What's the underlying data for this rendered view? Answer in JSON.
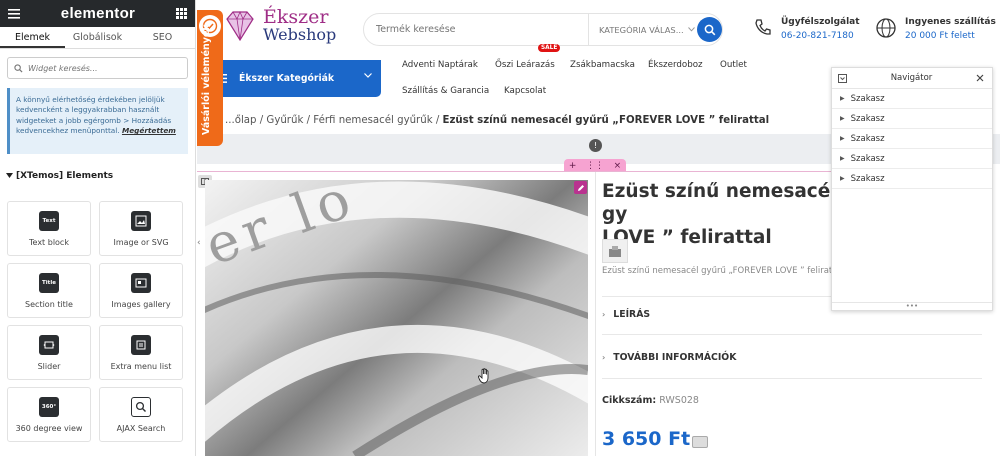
{
  "panel": {
    "logo": "elementor",
    "tabs": [
      "Elemek",
      "Globálisok",
      "SEO"
    ],
    "search_placeholder": "Widget keresés...",
    "notice_text": "A könnyű elérhetőség érdekében jelöljük kedvencként a leggyakrabban használt widgeteket a jobb egérgomb > Hozzáadás kedvencekhez menüponttal.",
    "notice_link": "Megértettem",
    "section_title": "[XTemos] Elements",
    "widgets": [
      "Text block",
      "Image or SVG",
      "Section title",
      "Images gallery",
      "Slider",
      "Extra menu list",
      "360 degree view",
      "AJAX Search"
    ],
    "widget_icon_texts": [
      "Text",
      "",
      "Title",
      "",
      "",
      "",
      "360°",
      ""
    ]
  },
  "site": {
    "logo_line1": "Ékszer",
    "logo_line2": "Webshop",
    "search_placeholder": "Termék keresése",
    "category_select": "KATEGÓRIA VÁLAS...",
    "support": {
      "title": "Ügyfélszolgálat",
      "value": "06-20-821-7180"
    },
    "shipping": {
      "title": "Ingyenes szállítás",
      "value": "20 000 Ft felett"
    },
    "review_tab": "Vásárlói vélemények",
    "category_button": "Ékszer Kategóriák",
    "nav": [
      "Adventi Naptárak",
      "Őszi Leárazás",
      "Zsákbamacska",
      "Ékszerdoboz",
      "Outlet",
      "Szállítás & Garancia",
      "Kapcsolat"
    ],
    "sale_badge": "SALE",
    "breadcrumb": [
      "...őlap",
      "Gyűrűk",
      "Férfi nemesacél gyűrűk"
    ],
    "breadcrumb_current": "Ezüst színű nemesacél gyűrű „FOREVER LOVE ” felirattal",
    "product_title_line1": "Ezüst színű nemesacél gy",
    "product_title_line2": "LOVE ” felirattal",
    "short_description": "Ezüst színű nemesacél gyűrű „FOREVER LOVE ” felirattal",
    "accordion": [
      "LEÍRÁS",
      "TOVÁBBI INFORMÁCIÓK"
    ],
    "sku_label": "Cikkszám:",
    "sku_value": "RWS028",
    "price": "3 650 Ft",
    "ring_engraving": "er lo",
    "info_glyph": "!"
  },
  "navigator": {
    "title": "Navigátor",
    "items": [
      "Szakasz",
      "Szakasz",
      "Szakasz",
      "Szakasz",
      "Szakasz"
    ]
  },
  "colors": {
    "accent_blue": "#1b67c9",
    "review_orange": "#ef6a19",
    "panel_dark": "#26292c",
    "handle_pink": "#f6a3d1",
    "sale_red": "#e01313"
  }
}
